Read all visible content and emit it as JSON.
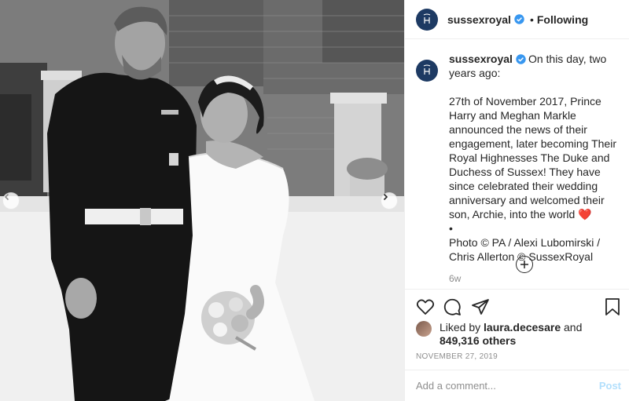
{
  "post": {
    "username": "sussexroyal",
    "follow_label": "Following",
    "caption_intro": "On this day, two years ago:",
    "caption_body": "27th of November 2017, Prince Harry and Meghan Markle announced the news of their engagement, later becoming Their Royal Highnesses The Duke and Duchess of Sussex! They have since celebrated their wedding anniversary and welcomed their son, Archie, into the world",
    "heart_emoji": "❤️",
    "bullet": "•",
    "credit": "Photo © PA / Alexi Lubomirski / Chris Allerton © SussexRoyal",
    "time_ago": "6w",
    "likes_prefix": "Liked by",
    "liked_by_user": "laura.decesare",
    "likes_and": "and",
    "likes_count": "849,316 others",
    "date": "NOVEMBER 27, 2019",
    "comment_placeholder": "Add a comment...",
    "post_label": "Post"
  },
  "icons": {
    "verified": "verified-badge-icon",
    "like": "heart-outline-icon",
    "comment": "comment-bubble-icon",
    "share": "paper-plane-icon",
    "save": "bookmark-icon",
    "more": "plus-circle-icon",
    "prev": "chevron-left-icon",
    "next": "chevron-right-icon"
  },
  "colors": {
    "verified": "#3897f0",
    "avatar_bg": "#1d3a63",
    "post_button_disabled": "#b2dffc",
    "muted_text": "#8e8e8e"
  }
}
